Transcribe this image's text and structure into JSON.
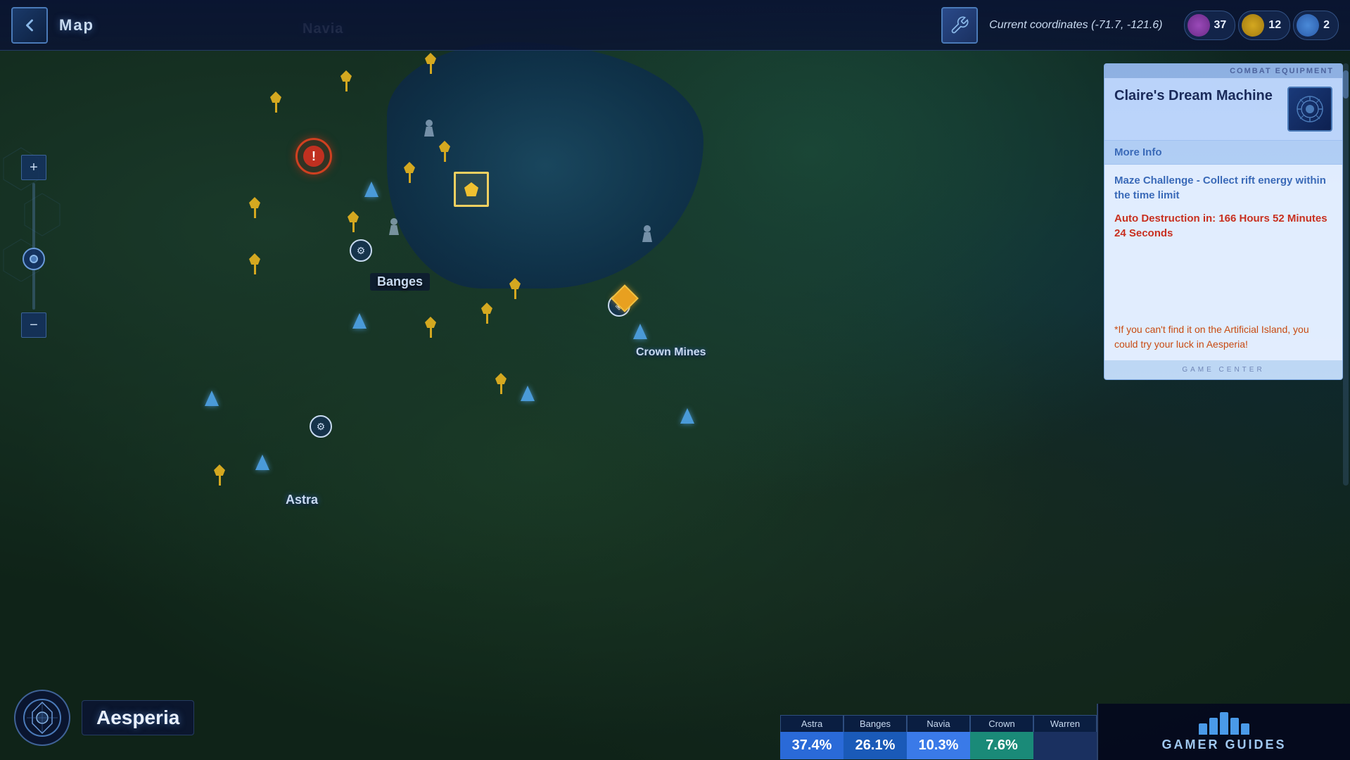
{
  "header": {
    "back_label": "←",
    "title": "Map",
    "coordinates_label": "Current coordinates (-71.7, -121.6)",
    "wrench_icon": "wrench"
  },
  "resources": [
    {
      "id": "r1",
      "color": "purple",
      "count": "37"
    },
    {
      "id": "r2",
      "color": "yellow",
      "count": "12"
    },
    {
      "id": "r3",
      "color": "blue-res",
      "count": "2"
    }
  ],
  "map": {
    "labels": {
      "navia": "Navia",
      "banges": "Banges",
      "crown_mines": "Crown Mines",
      "astra": "Astra"
    }
  },
  "info_panel": {
    "top_bar_label": "COMBAT EQUIPMENT",
    "title": "Claire's Dream Machine",
    "more_info_label": "More Info",
    "challenge_text": "Maze Challenge - Collect rift energy within the time limit",
    "timer_label": "Auto Destruction in: 166 Hours 52 Minutes 24 Seconds",
    "tip_text": "*If you can't find it on the Artificial Island, you could try your luck in Aesperia!",
    "bottom_label": "GAME CENTER"
  },
  "region_indicator": {
    "name": "Aesperia"
  },
  "region_tabs": [
    {
      "label": "Astra",
      "pct": "37.4%",
      "color": "blue"
    },
    {
      "label": "Banges",
      "pct": "26.1%",
      "color": "mid-blue"
    },
    {
      "label": "Navia",
      "pct": "10.3%",
      "color": "light-blue"
    },
    {
      "label": "Crown",
      "pct": "7.6%",
      "color": "teal"
    },
    {
      "label": "Warren",
      "pct": "",
      "color": "dark"
    }
  ],
  "gamer_guides": {
    "text": "GAMER GUIDES"
  },
  "zoom": {
    "plus": "+",
    "minus": "−"
  }
}
